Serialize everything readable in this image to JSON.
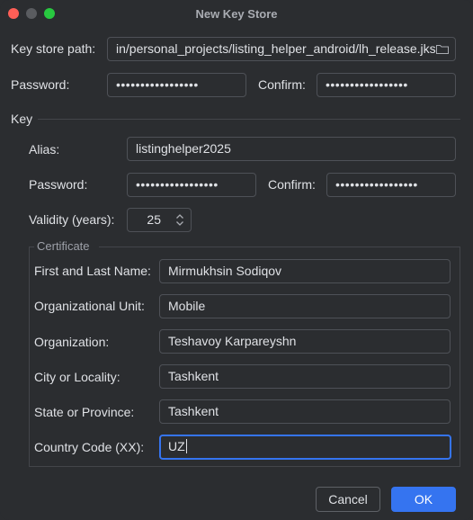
{
  "window": {
    "title": "New Key Store"
  },
  "keystore": {
    "path_label": "Key store path:",
    "path_value": "in/personal_projects/listing_helper_android/lh_release.jks",
    "password_label": "Password:",
    "password_value": "•••••••••••••••••",
    "confirm_label": "Confirm:",
    "confirm_value": "•••••••••••••••••"
  },
  "key": {
    "section_label": "Key",
    "alias_label": "Alias:",
    "alias_value": "listinghelper2025",
    "password_label": "Password:",
    "password_value": "•••••••••••••••••",
    "confirm_label": "Confirm:",
    "confirm_value": "•••••••••••••••••",
    "validity_label": "Validity (years):",
    "validity_value": "25"
  },
  "certificate": {
    "section_label": "Certificate",
    "fields": [
      {
        "label": "First and Last Name:",
        "value": "Mirmukhsin Sodiqov"
      },
      {
        "label": "Organizational Unit:",
        "value": "Mobile"
      },
      {
        "label": "Organization:",
        "value": "Teshavoy Karpareyshn"
      },
      {
        "label": "City or Locality:",
        "value": "Tashkent"
      },
      {
        "label": "State or Province:",
        "value": "Tashkent"
      },
      {
        "label": "Country Code (XX):",
        "value": "UZ"
      }
    ]
  },
  "buttons": {
    "cancel_label": "Cancel",
    "ok_label": "OK"
  },
  "colors": {
    "background": "#2b2d30",
    "accent": "#3574f0",
    "field_border": "#4e5157"
  },
  "icons": {
    "browse": "folder-icon",
    "spinner": "spinner-arrows-icon"
  }
}
